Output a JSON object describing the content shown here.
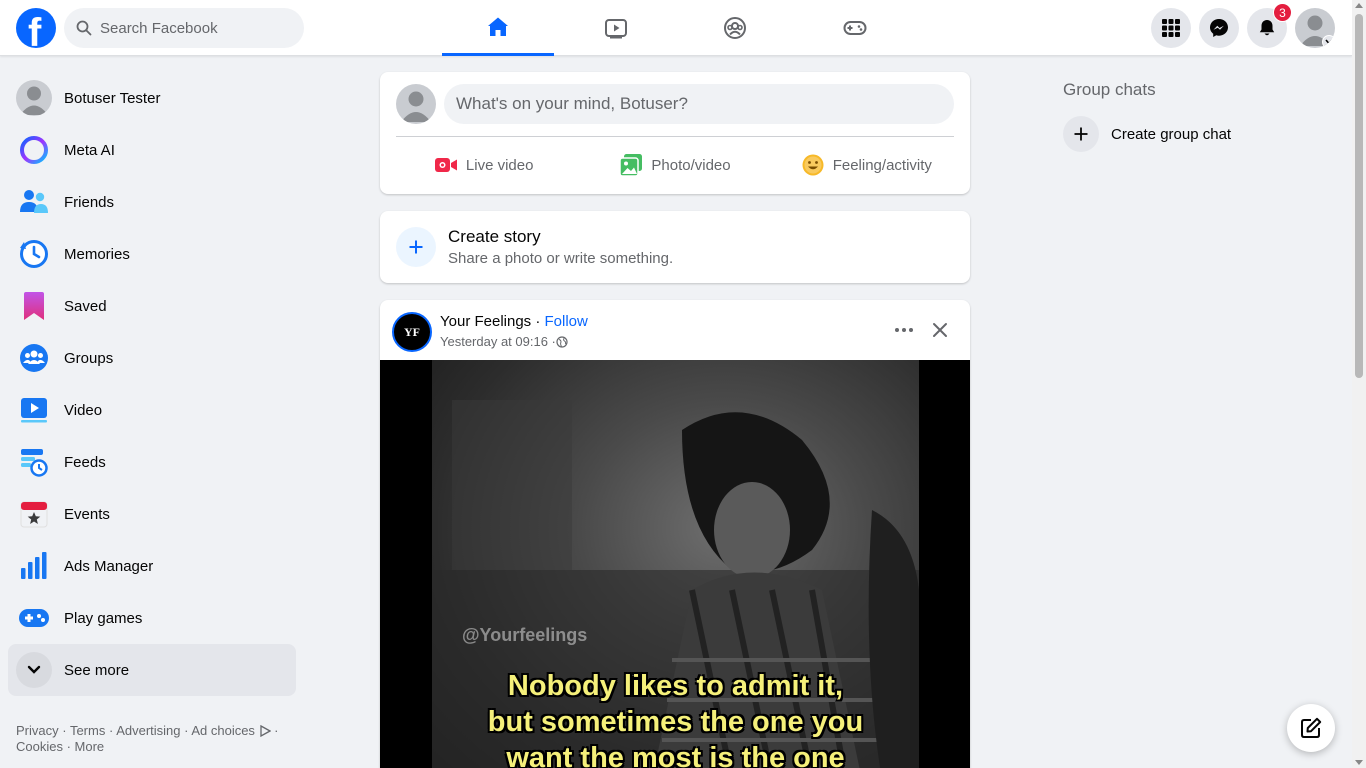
{
  "header": {
    "search_placeholder": "Search Facebook",
    "notification_count": "3"
  },
  "sidebar": {
    "items": [
      {
        "label": "Botuser Tester",
        "icon": "profile-avatar"
      },
      {
        "label": "Meta AI",
        "icon": "meta-ai-icon"
      },
      {
        "label": "Friends",
        "icon": "friends-icon"
      },
      {
        "label": "Memories",
        "icon": "memories-icon"
      },
      {
        "label": "Saved",
        "icon": "saved-icon"
      },
      {
        "label": "Groups",
        "icon": "groups-icon"
      },
      {
        "label": "Video",
        "icon": "video-icon"
      },
      {
        "label": "Feeds",
        "icon": "feeds-icon"
      },
      {
        "label": "Events",
        "icon": "events-icon"
      },
      {
        "label": "Ads Manager",
        "icon": "ads-manager-icon"
      },
      {
        "label": "Play games",
        "icon": "play-games-icon"
      },
      {
        "label": "See more",
        "icon": "chevron-down-icon"
      }
    ],
    "footer": {
      "privacy": "Privacy",
      "terms": "Terms",
      "advertising": "Advertising",
      "ad_choices": "Ad choices",
      "cookies": "Cookies",
      "more": "More"
    }
  },
  "composer": {
    "placeholder": "What's on your mind, Botuser?",
    "live_video": "Live video",
    "photo_video": "Photo/video",
    "feeling_activity": "Feeling/activity"
  },
  "story": {
    "title": "Create story",
    "subtitle": "Share a photo or write something."
  },
  "post": {
    "avatar_text": "YF",
    "author": "Your Feelings",
    "separator": " · ",
    "follow": "Follow",
    "time": "Yesterday at 09:16 · ",
    "watermark": "@Yourfeelings",
    "caption_line1": "Nobody likes to admit it,",
    "caption_line2": "but sometimes the one you",
    "caption_line3": "want the most is the one"
  },
  "right": {
    "group_chats_title": "Group chats",
    "create_group_chat": "Create group chat"
  },
  "colors": {
    "brand": "#0866ff",
    "badge": "#e41e3f",
    "caption": "#f5f07a"
  }
}
